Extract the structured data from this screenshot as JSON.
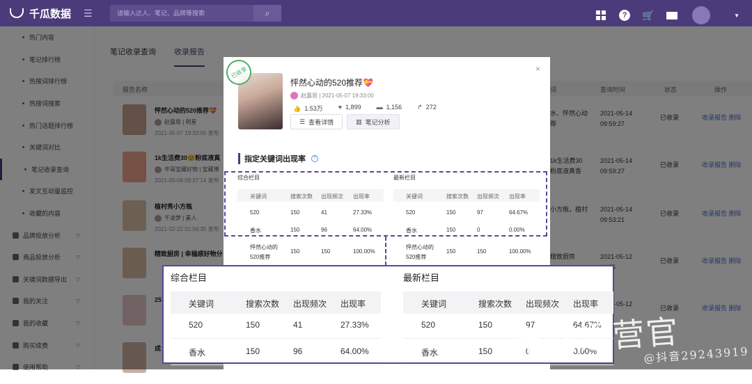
{
  "app": {
    "name": "千瓜数据"
  },
  "search": {
    "placeholder": "请输入达人、笔记、品牌等搜索"
  },
  "sidebar": {
    "items": [
      {
        "label": "热门内容",
        "type": "sub"
      },
      {
        "label": "笔记排行榜",
        "type": "sub"
      },
      {
        "label": "热搜词排行榜",
        "type": "sub"
      },
      {
        "label": "热搜词搜索",
        "type": "sub"
      },
      {
        "label": "热门话题排行榜",
        "type": "sub"
      },
      {
        "label": "关键词对比",
        "type": "sub"
      },
      {
        "label": "笔记收录查询",
        "type": "sub",
        "active": true
      },
      {
        "label": "发文互动量监控",
        "type": "sub"
      },
      {
        "label": "收藏的内容",
        "type": "sub"
      },
      {
        "label": "品牌投放分析",
        "type": "group"
      },
      {
        "label": "商品投放分析",
        "type": "group"
      },
      {
        "label": "关键词数据导出",
        "type": "group"
      },
      {
        "label": "我的关注",
        "type": "group"
      },
      {
        "label": "我的收藏",
        "type": "group"
      },
      {
        "label": "购买续费",
        "type": "group"
      },
      {
        "label": "使用帮助",
        "type": "group"
      }
    ]
  },
  "tabs": [
    {
      "label": "笔记收录查询"
    },
    {
      "label": "收录报告"
    }
  ],
  "table": {
    "headers": {
      "name": "报告名称",
      "kw": "词",
      "qtime": "查询时间",
      "status": "状态",
      "ops": "操作"
    },
    "rows": [
      {
        "title": "怦然心动的520推荐💝",
        "author": "赵露思 | 明星",
        "date": "2021-05-07 19:33:00 发布",
        "kw1": "水、怦然心动",
        "kw2": "荐",
        "t1": "2021-05-14",
        "t2": "09:59:27",
        "status": "已收录",
        "op1": "收录报告",
        "op2": "删除"
      },
      {
        "title": "1k生活费30🙂粉底液真",
        "author": "毕哥宝藏好物 | 宝藏博",
        "date": "2021-05-08 09:37:14 发布",
        "kw1": "1k生活费30",
        "kw2": "粉底液真香",
        "t1": "2021-05-14",
        "t2": "09:59:27",
        "status": "已收录",
        "op1": "收录报告",
        "op2": "删除"
      },
      {
        "title": "植村秀小方瓶",
        "author": "千凌梦 | 素人",
        "date": "2021-02-22 01:56:35 发布",
        "kw1": "小方瓶，植村",
        "kw2": "",
        "t1": "2021-05-14",
        "t2": "09:53:21",
        "status": "已收录",
        "op1": "收录报告",
        "op2": "删除"
      },
      {
        "title": "精致厨房 | 幸福感好物分",
        "author": "",
        "date": "",
        "kw1": "精致厨房",
        "kw2": "",
        "t1": "2021-05-12",
        "t2": "11:25",
        "status": "已收录",
        "op1": "收录报告",
        "op2": "删除"
      },
      {
        "title": "25",
        "author": "",
        "date": "",
        "kw1": "",
        "kw2": "",
        "t1": "2021-05-12",
        "t2": "",
        "status": "已收录",
        "op1": "收录报告",
        "op2": "删除"
      },
      {
        "title": "成",
        "author": "",
        "date": "",
        "kw1": "",
        "kw2": "",
        "t1": "",
        "t2": "",
        "status": "",
        "op1": "",
        "op2": ""
      }
    ]
  },
  "modal": {
    "stamp": "已收录",
    "title": "怦然心动的520推荐💝",
    "meta": "赵露思 | 2021-05-07 19:33:00",
    "stats": {
      "likes": "1.53万",
      "collects": "1,899",
      "comments": "1,156",
      "shares": "272"
    },
    "btn_detail": "查看详情",
    "btn_analysis": "笔记分析",
    "section_title": "指定关键词出现率",
    "close": "×"
  },
  "keyword_tables": {
    "columns": [
      "关键词",
      "搜索次数",
      "出现频次",
      "出现率"
    ],
    "composite": {
      "caption": "综合栏目",
      "rows": [
        [
          "520",
          "150",
          "41",
          "27.33%"
        ],
        [
          "香水",
          "150",
          "96",
          "64.00%"
        ],
        [
          "怦然心动的520推荐",
          "150",
          "150",
          "100.00%"
        ]
      ]
    },
    "latest": {
      "caption": "最新栏目",
      "rows": [
        [
          "520",
          "150",
          "97",
          "64.67%"
        ],
        [
          "香水",
          "150",
          "0",
          "0.00%"
        ],
        [
          "怦然心动的520推荐",
          "150",
          "150",
          "100.00%"
        ]
      ]
    }
  },
  "watermark": {
    "main": "电商运营官",
    "sub": "@抖音29243919"
  },
  "colors": {
    "brand": "#4b3b7a",
    "link": "#4b6fd1",
    "dash": "#5b4596"
  }
}
